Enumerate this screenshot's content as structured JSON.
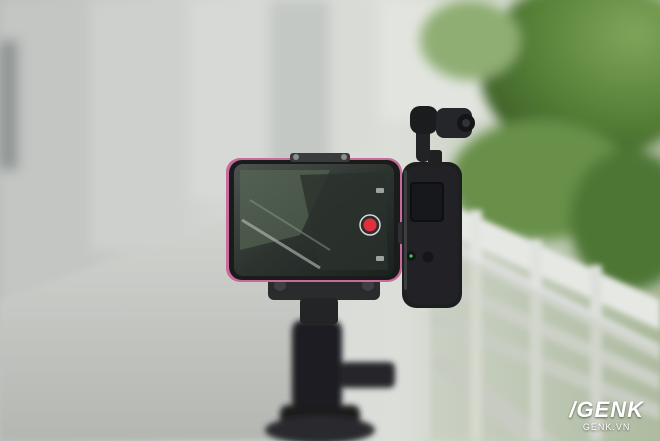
{
  "watermark": {
    "logo": "/GENK",
    "site": "GENK.VN"
  },
  "colors": {
    "sky": "#dfe3dd",
    "wall": "#c9ccc9",
    "foliage": "#5e8a3e",
    "phone_accent": "#c86a9a",
    "record_button": "#e0303c",
    "gimbal_body": "#1d1e20"
  }
}
